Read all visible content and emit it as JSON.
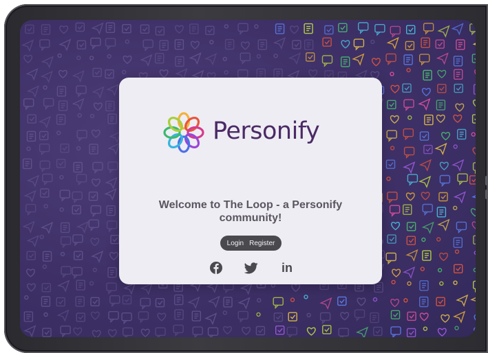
{
  "brand": {
    "name": "Personify",
    "text_color": "#4b2a66",
    "mark_colors": [
      "#f2b23a",
      "#e8553c",
      "#d63a8c",
      "#9b45d6",
      "#4a6fe8",
      "#38b4e0",
      "#3cb870",
      "#a8cf3a"
    ]
  },
  "welcome": {
    "line1": "Welcome to The Loop - a Personify",
    "line2": "community!"
  },
  "auth": {
    "login_label": "Login",
    "register_label": "Register"
  },
  "social": {
    "facebook": "facebook-icon",
    "twitter": "twitter-icon",
    "linkedin": "linkedin-icon",
    "linkedin_glyph": "in"
  },
  "theme": {
    "background": "#3f3168",
    "card": "#eeedf3",
    "pill": "#4a4a4e",
    "icon": "#4a4a4e"
  }
}
